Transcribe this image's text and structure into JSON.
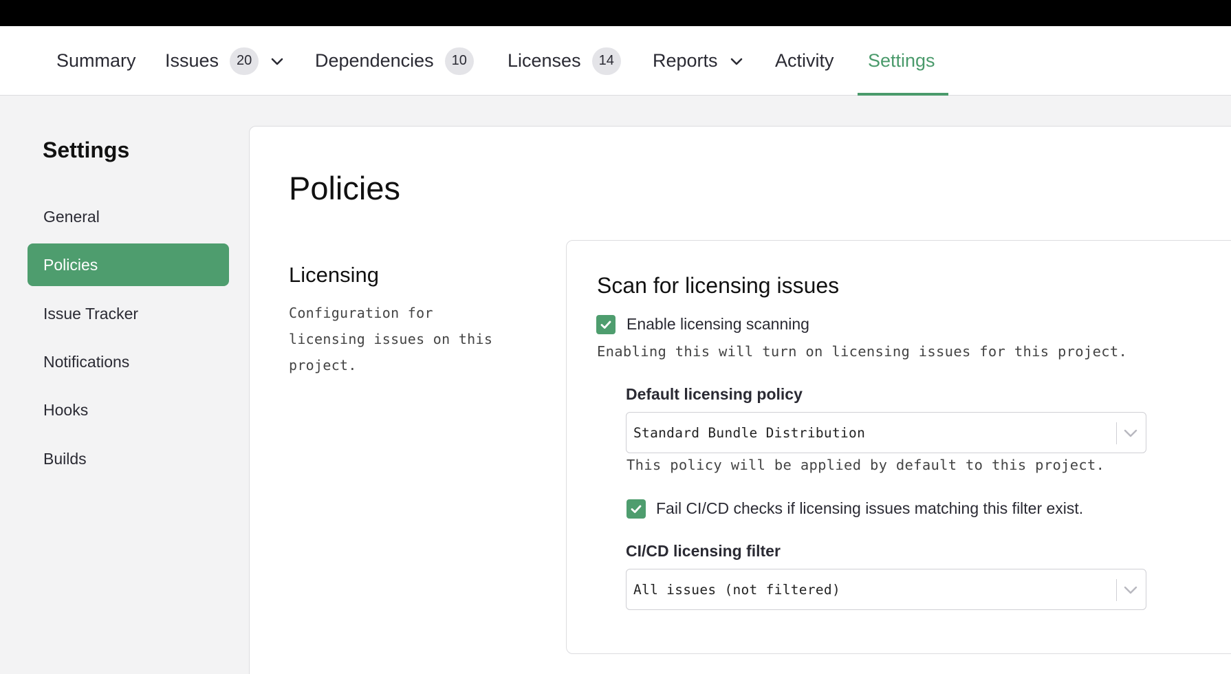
{
  "nav": {
    "items": [
      {
        "label": "Summary"
      },
      {
        "label": "Issues",
        "count": "20"
      },
      {
        "label": "Dependencies",
        "count": "10"
      },
      {
        "label": "Licenses",
        "count": "14"
      },
      {
        "label": "Reports"
      },
      {
        "label": "Activity"
      },
      {
        "label": "Settings",
        "active": true
      }
    ]
  },
  "sidebar": {
    "title": "Settings",
    "items": [
      {
        "label": "General"
      },
      {
        "label": "Policies",
        "active": true
      },
      {
        "label": "Issue Tracker"
      },
      {
        "label": "Notifications"
      },
      {
        "label": "Hooks"
      },
      {
        "label": "Builds"
      }
    ]
  },
  "main": {
    "title": "Policies",
    "section": {
      "title": "Licensing",
      "description": "Configuration for licensing issues on this project."
    },
    "card": {
      "title": "Scan for licensing issues",
      "enable": {
        "label": "Enable licensing scanning",
        "checked": true,
        "help": "Enabling this will turn on licensing issues for this project."
      },
      "policy": {
        "label": "Default licensing policy",
        "value": "Standard Bundle Distribution",
        "help": "This policy will be applied by default to this project."
      },
      "fail_check": {
        "label": "Fail CI/CD checks if licensing issues matching this filter exist.",
        "checked": true
      },
      "filter": {
        "label": "CI/CD licensing filter",
        "value": "All issues (not filtered)"
      }
    }
  },
  "colors": {
    "accent": "#4e9d6e",
    "active_text": "#4a9a6b"
  }
}
